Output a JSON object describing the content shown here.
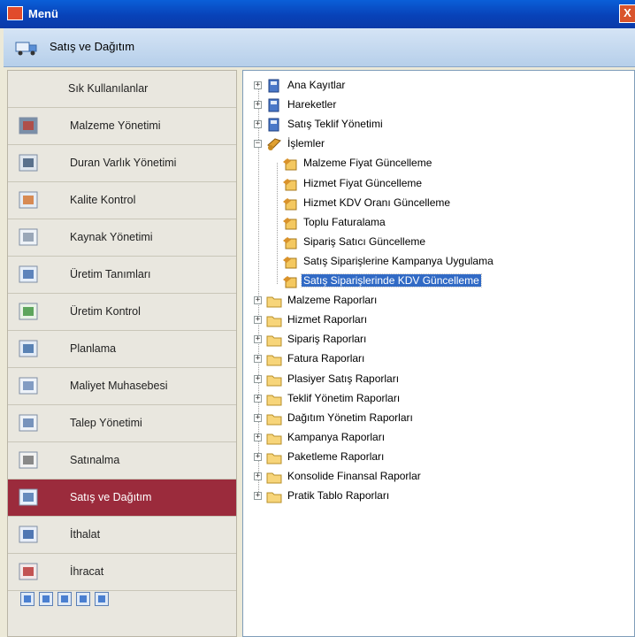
{
  "window": {
    "title": "Menü",
    "close_label": "X"
  },
  "header": {
    "title": "Satış ve Dağıtım",
    "icon": "truck-icon"
  },
  "sidebar": {
    "items": [
      {
        "label": "Sık Kullanılanlar",
        "icon": ""
      },
      {
        "label": "Malzeme Yönetimi",
        "icon": "materials-icon"
      },
      {
        "label": "Duran Varlık Yönetimi",
        "icon": "fixed-asset-icon"
      },
      {
        "label": "Kalite Kontrol",
        "icon": "quality-icon"
      },
      {
        "label": "Kaynak Yönetimi",
        "icon": "resource-icon"
      },
      {
        "label": "Üretim Tanımları",
        "icon": "production-def-icon"
      },
      {
        "label": "Üretim Kontrol",
        "icon": "production-control-icon"
      },
      {
        "label": "Planlama",
        "icon": "planning-icon"
      },
      {
        "label": "Maliyet Muhasebesi",
        "icon": "cost-accounting-icon"
      },
      {
        "label": "Talep Yönetimi",
        "icon": "demand-icon"
      },
      {
        "label": "Satınalma",
        "icon": "purchasing-icon"
      },
      {
        "label": "Satış ve Dağıtım",
        "icon": "truck-icon",
        "active": true
      },
      {
        "label": "İthalat",
        "icon": "import-icon"
      },
      {
        "label": "İhracat",
        "icon": "export-icon"
      }
    ],
    "bottom_icons": [
      "sidebar-shortcut-icon-1",
      "sidebar-shortcut-icon-2",
      "sidebar-shortcut-icon-3",
      "sidebar-shortcut-icon-4",
      "sidebar-shortcut-icon-5"
    ]
  },
  "tree": {
    "nodes": [
      {
        "label": "Ana Kayıtlar",
        "level": 0,
        "expander": "+",
        "icon": "book-icon"
      },
      {
        "label": "Hareketler",
        "level": 0,
        "expander": "+",
        "icon": "book-icon"
      },
      {
        "label": "Satış Teklif Yönetimi",
        "level": 0,
        "expander": "+",
        "icon": "book-icon"
      },
      {
        "label": "İşlemler",
        "level": 0,
        "expander": "−",
        "icon": "process-icon"
      },
      {
        "label": "Malzeme Fiyat Güncelleme",
        "level": 1,
        "icon": "process-item-icon"
      },
      {
        "label": "Hizmet Fiyat Güncelleme",
        "level": 1,
        "icon": "process-item-icon"
      },
      {
        "label": "Hizmet KDV Oranı Güncelleme",
        "level": 1,
        "icon": "process-item-icon"
      },
      {
        "label": "Toplu Faturalama",
        "level": 1,
        "icon": "process-item-icon"
      },
      {
        "label": "Sipariş Satıcı Güncelleme",
        "level": 1,
        "icon": "process-item-icon"
      },
      {
        "label": "Satış Siparişlerine Kampanya Uygulama",
        "level": 1,
        "icon": "process-item-icon"
      },
      {
        "label": "Satış Siparişlerinde KDV Güncelleme",
        "level": 1,
        "icon": "process-item-icon",
        "selected": true
      },
      {
        "label": "Malzeme Raporları",
        "level": 0,
        "expander": "+",
        "icon": "folder-icon"
      },
      {
        "label": "Hizmet Raporları",
        "level": 0,
        "expander": "+",
        "icon": "folder-icon"
      },
      {
        "label": "Sipariş Raporları",
        "level": 0,
        "expander": "+",
        "icon": "folder-icon"
      },
      {
        "label": "Fatura Raporları",
        "level": 0,
        "expander": "+",
        "icon": "folder-icon"
      },
      {
        "label": "Plasiyer Satış Raporları",
        "level": 0,
        "expander": "+",
        "icon": "folder-icon"
      },
      {
        "label": "Teklif Yönetim Raporları",
        "level": 0,
        "expander": "+",
        "icon": "folder-icon"
      },
      {
        "label": "Dağıtım Yönetim Raporları",
        "level": 0,
        "expander": "+",
        "icon": "folder-icon"
      },
      {
        "label": "Kampanya Raporları",
        "level": 0,
        "expander": "+",
        "icon": "folder-icon"
      },
      {
        "label": "Paketleme Raporları",
        "level": 0,
        "expander": "+",
        "icon": "folder-icon"
      },
      {
        "label": "Konsolide Finansal Raporlar",
        "level": 0,
        "expander": "+",
        "icon": "folder-icon"
      },
      {
        "label": "Pratik Tablo Raporları",
        "level": 0,
        "expander": "+",
        "icon": "folder-icon"
      }
    ]
  }
}
